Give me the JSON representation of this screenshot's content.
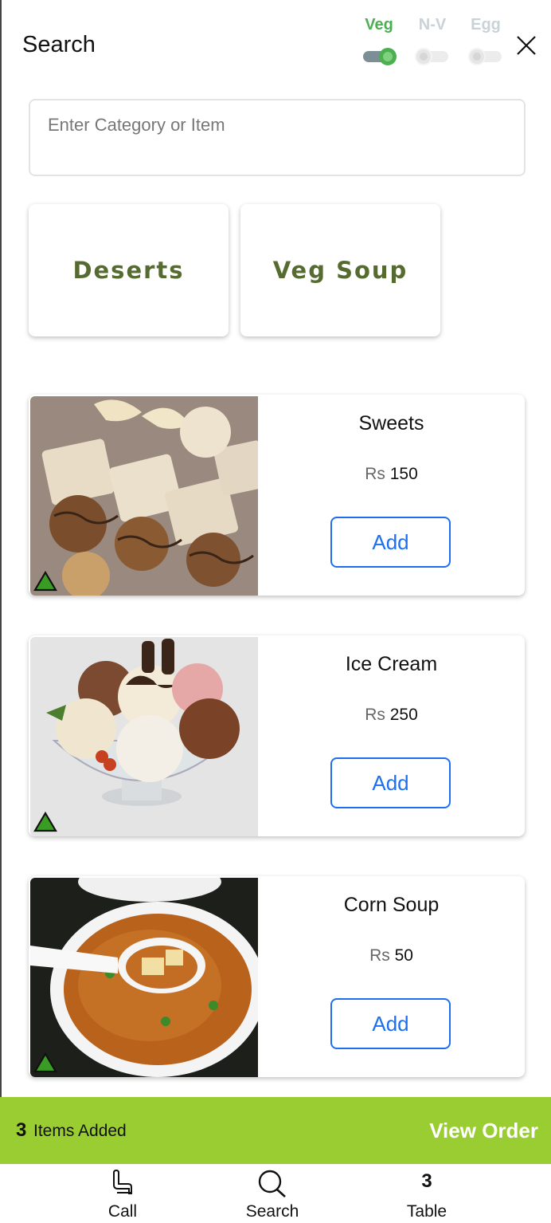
{
  "header": {
    "title": "Search",
    "filters": [
      {
        "label": "Veg",
        "on": true
      },
      {
        "label": "N-V",
        "on": false
      },
      {
        "label": "Egg",
        "on": false
      }
    ]
  },
  "search": {
    "placeholder": "Enter Category or Item",
    "value": ""
  },
  "categories": [
    "Deserts",
    "Veg Soup"
  ],
  "items": [
    {
      "name": "Sweets",
      "currency": "Rs",
      "price": "150",
      "add_label": "Add",
      "veg_icon": "veg-triangle-icon"
    },
    {
      "name": "Ice Cream",
      "currency": "Rs",
      "price": "250",
      "add_label": "Add",
      "veg_icon": "veg-triangle-icon"
    },
    {
      "name": "Corn Soup",
      "currency": "Rs",
      "price": "50",
      "add_label": "Add",
      "veg_icon": "veg-triangle-icon"
    }
  ],
  "order_bar": {
    "count": "3",
    "label": "Items Added",
    "action": "View Order"
  },
  "bottom_nav": {
    "call_label": "Call",
    "search_label": "Search",
    "table_number": "3",
    "table_label": "Table"
  },
  "colors": {
    "accent_green": "#9acd32",
    "veg_green": "#4caf50",
    "category_text": "#556b2f",
    "button_blue": "#1e6ff0"
  }
}
